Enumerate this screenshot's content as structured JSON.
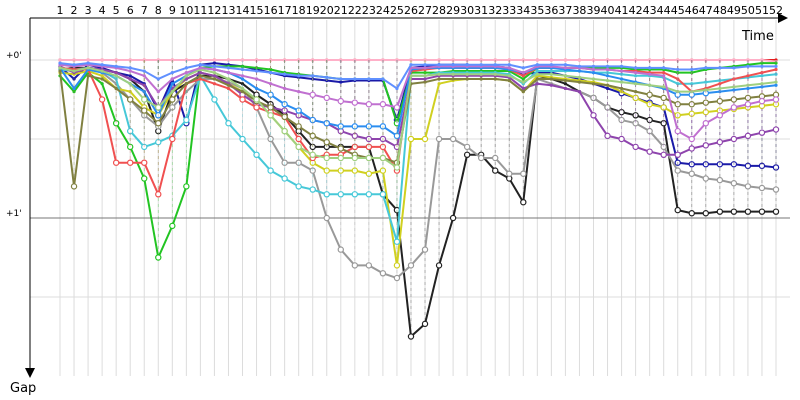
{
  "chart_data": {
    "type": "line",
    "xlabel": "Time",
    "ylabel": "Gap",
    "x_ticks": [
      "1",
      "2",
      "3",
      "4",
      "5",
      "6",
      "7",
      "8",
      "9",
      "10",
      "11",
      "12",
      "13",
      "14",
      "15",
      "16",
      "17",
      "18",
      "19",
      "20",
      "21",
      "22",
      "23",
      "24",
      "25",
      "26",
      "27",
      "28",
      "29",
      "30",
      "31",
      "32",
      "33",
      "34",
      "35",
      "36",
      "37",
      "38",
      "39",
      "40",
      "41",
      "42",
      "43",
      "44",
      "45",
      "46",
      "47",
      "48",
      "49",
      "50",
      "51",
      "52"
    ],
    "x_tick_labels": [
      "1",
      "2",
      "3",
      "4",
      "5",
      "6",
      "7",
      "8",
      "9",
      "10",
      "11",
      "12",
      "13",
      "14",
      "15",
      "16",
      "17",
      "18",
      "19",
      "20",
      "21",
      "22",
      "23",
      "24",
      "25",
      "26",
      "27",
      "28",
      "29",
      "30",
      "31",
      "32",
      "33",
      "34",
      "35",
      "36",
      "37",
      "38",
      "39",
      "40",
      "41",
      "42",
      "43",
      "44",
      "45",
      "46",
      "47",
      "48",
      "49",
      "50",
      "51",
      "52"
    ],
    "y_ticks": [
      0,
      1
    ],
    "y_tick_labels": [
      "+0'",
      "+1'"
    ],
    "ylim": [
      0,
      2
    ],
    "grid": true,
    "legend": "none",
    "series": [
      {
        "color": "#e31a1c",
        "values": [
          0.0,
          0.0,
          0.0,
          0.0,
          0.0,
          0.0,
          0.0,
          0.0,
          0.0,
          0.0,
          0.0,
          0.0,
          0.0,
          0.0,
          0.0,
          0.0,
          0.0,
          0.0,
          0.0,
          0.0,
          0.0,
          0.0,
          0.0,
          0.0,
          0.0,
          0.0,
          0.0,
          0.0,
          0.0,
          0.0,
          0.0,
          0.0,
          0.0,
          0.0,
          0.0,
          0.0,
          0.0,
          0.0,
          0.0,
          0.0,
          0.0,
          0.0,
          0.0,
          0.0,
          0.0,
          0.0,
          0.0,
          0.0,
          0.0,
          0.0,
          0.0,
          0.0
        ]
      },
      {
        "color": "#ffb0c8",
        "values": [
          0.0,
          0.0,
          0.0,
          0.0,
          0.0,
          0.0,
          0.0,
          0.0,
          0.0,
          0.0,
          0.0,
          0.0,
          0.0,
          0.0,
          0.0,
          0.0,
          0.0,
          0.0,
          0.0,
          0.0,
          0.0,
          0.0,
          0.0,
          0.0,
          0.0,
          0.0,
          0.0,
          0.0,
          0.0,
          0.0,
          0.0,
          0.0,
          0.0,
          0.0,
          0.0,
          0.0,
          0.0,
          0.0,
          0.0,
          0.0,
          0.0,
          0.0,
          0.0,
          0.0,
          0.0,
          0.0,
          0.0,
          0.0,
          0.0,
          0.0,
          0.0,
          0.01
        ]
      },
      {
        "color": "#1a1aa8",
        "values": [
          0.04,
          0.12,
          0.03,
          0.05,
          0.08,
          0.1,
          0.15,
          0.32,
          0.12,
          0.4,
          0.03,
          0.02,
          0.03,
          0.04,
          0.06,
          0.08,
          0.1,
          0.11,
          0.12,
          0.13,
          0.14,
          0.13,
          0.13,
          0.13,
          0.38,
          0.05,
          0.04,
          0.03,
          0.03,
          0.03,
          0.04,
          0.04,
          0.05,
          0.09,
          0.08,
          0.08,
          0.1,
          0.12,
          0.15,
          0.18,
          0.21,
          0.24,
          0.27,
          0.3,
          0.65,
          0.66,
          0.66,
          0.66,
          0.66,
          0.67,
          0.67,
          0.68
        ]
      },
      {
        "color": "#222222",
        "values": [
          0.06,
          0.05,
          0.05,
          0.06,
          0.08,
          0.12,
          0.2,
          0.45,
          0.2,
          0.15,
          0.1,
          0.1,
          0.12,
          0.15,
          0.22,
          0.28,
          0.35,
          0.45,
          0.55,
          0.55,
          0.55,
          0.55,
          0.55,
          0.85,
          0.95,
          1.75,
          1.67,
          1.3,
          1.0,
          0.6,
          0.6,
          0.7,
          0.75,
          0.9,
          0.1,
          0.12,
          0.15,
          0.2,
          0.24,
          0.3,
          0.33,
          0.35,
          0.38,
          0.4,
          0.95,
          0.97,
          0.97,
          0.96,
          0.96,
          0.96,
          0.96,
          0.96
        ]
      },
      {
        "color": "#999999",
        "values": [
          0.05,
          0.06,
          0.05,
          0.08,
          0.15,
          0.25,
          0.35,
          0.42,
          0.3,
          0.2,
          0.12,
          0.12,
          0.14,
          0.18,
          0.3,
          0.5,
          0.65,
          0.65,
          0.7,
          1.0,
          1.2,
          1.3,
          1.3,
          1.35,
          1.38,
          1.3,
          1.2,
          0.5,
          0.5,
          0.55,
          0.62,
          0.62,
          0.72,
          0.72,
          0.12,
          0.15,
          0.18,
          0.2,
          0.24,
          0.3,
          0.38,
          0.4,
          0.45,
          0.55,
          0.7,
          0.72,
          0.75,
          0.76,
          0.78,
          0.8,
          0.81,
          0.82
        ]
      },
      {
        "color": "#22c422",
        "values": [
          0.1,
          0.2,
          0.08,
          0.15,
          0.4,
          0.55,
          0.75,
          1.25,
          1.05,
          0.8,
          0.05,
          0.04,
          0.04,
          0.04,
          0.05,
          0.06,
          0.08,
          0.09,
          0.1,
          0.11,
          0.12,
          0.12,
          0.12,
          0.12,
          0.4,
          0.08,
          0.08,
          0.08,
          0.07,
          0.07,
          0.07,
          0.07,
          0.07,
          0.12,
          0.05,
          0.05,
          0.05,
          0.05,
          0.05,
          0.05,
          0.05,
          0.06,
          0.06,
          0.06,
          0.08,
          0.08,
          0.06,
          0.05,
          0.04,
          0.03,
          0.02,
          0.02
        ]
      },
      {
        "color": "#d0d020",
        "values": [
          0.08,
          0.09,
          0.07,
          0.1,
          0.18,
          0.2,
          0.3,
          0.35,
          0.2,
          0.12,
          0.08,
          0.1,
          0.15,
          0.2,
          0.25,
          0.35,
          0.45,
          0.55,
          0.65,
          0.7,
          0.7,
          0.7,
          0.72,
          0.7,
          1.3,
          0.5,
          0.5,
          0.15,
          0.13,
          0.12,
          0.12,
          0.12,
          0.13,
          0.2,
          0.1,
          0.11,
          0.12,
          0.13,
          0.14,
          0.16,
          0.2,
          0.24,
          0.28,
          0.3,
          0.35,
          0.34,
          0.33,
          0.32,
          0.31,
          0.3,
          0.29,
          0.28
        ]
      },
      {
        "color": "#46c8d8",
        "values": [
          0.06,
          0.07,
          0.05,
          0.07,
          0.12,
          0.45,
          0.55,
          0.52,
          0.48,
          0.38,
          0.1,
          0.25,
          0.4,
          0.5,
          0.6,
          0.7,
          0.75,
          0.8,
          0.82,
          0.85,
          0.85,
          0.85,
          0.85,
          0.85,
          1.15,
          0.1,
          0.1,
          0.08,
          0.08,
          0.08,
          0.08,
          0.08,
          0.09,
          0.15,
          0.07,
          0.07,
          0.07,
          0.07,
          0.08,
          0.08,
          0.09,
          0.1,
          0.1,
          0.11,
          0.15,
          0.15,
          0.14,
          0.13,
          0.12,
          0.11,
          0.1,
          0.09
        ]
      },
      {
        "color": "#8e44ad",
        "values": [
          0.04,
          0.08,
          0.05,
          0.06,
          0.08,
          0.12,
          0.16,
          0.3,
          0.18,
          0.12,
          0.08,
          0.1,
          0.15,
          0.22,
          0.28,
          0.3,
          0.32,
          0.35,
          0.38,
          0.4,
          0.45,
          0.48,
          0.5,
          0.5,
          0.55,
          0.12,
          0.12,
          0.1,
          0.1,
          0.1,
          0.1,
          0.1,
          0.11,
          0.18,
          0.15,
          0.16,
          0.18,
          0.2,
          0.35,
          0.48,
          0.5,
          0.55,
          0.58,
          0.6,
          0.6,
          0.56,
          0.54,
          0.52,
          0.5,
          0.48,
          0.46,
          0.44
        ]
      },
      {
        "color": "#f05050",
        "values": [
          0.05,
          0.06,
          0.06,
          0.25,
          0.65,
          0.65,
          0.65,
          0.85,
          0.5,
          0.15,
          0.12,
          0.15,
          0.18,
          0.25,
          0.3,
          0.33,
          0.36,
          0.5,
          0.62,
          0.6,
          0.6,
          0.55,
          0.55,
          0.55,
          0.7,
          0.07,
          0.06,
          0.05,
          0.05,
          0.05,
          0.05,
          0.05,
          0.06,
          0.1,
          0.05,
          0.05,
          0.05,
          0.05,
          0.06,
          0.06,
          0.07,
          0.07,
          0.08,
          0.08,
          0.12,
          0.2,
          0.18,
          0.15,
          0.12,
          0.1,
          0.08,
          0.06
        ]
      },
      {
        "color": "#2a8df0",
        "values": [
          0.05,
          0.18,
          0.06,
          0.08,
          0.1,
          0.15,
          0.2,
          0.35,
          0.15,
          0.1,
          0.05,
          0.06,
          0.08,
          0.12,
          0.18,
          0.22,
          0.28,
          0.32,
          0.38,
          0.4,
          0.42,
          0.42,
          0.42,
          0.42,
          0.48,
          0.06,
          0.05,
          0.05,
          0.05,
          0.05,
          0.05,
          0.05,
          0.06,
          0.08,
          0.05,
          0.05,
          0.06,
          0.07,
          0.08,
          0.1,
          0.12,
          0.14,
          0.16,
          0.18,
          0.22,
          0.22,
          0.21,
          0.2,
          0.19,
          0.18,
          0.17,
          0.16
        ]
      },
      {
        "color": "#808040",
        "values": [
          0.07,
          0.8,
          0.1,
          0.12,
          0.18,
          0.25,
          0.32,
          0.4,
          0.25,
          0.15,
          0.1,
          0.12,
          0.16,
          0.2,
          0.26,
          0.3,
          0.36,
          0.42,
          0.48,
          0.52,
          0.56,
          0.6,
          0.62,
          0.62,
          0.65,
          0.15,
          0.14,
          0.12,
          0.12,
          0.12,
          0.12,
          0.12,
          0.13,
          0.2,
          0.12,
          0.12,
          0.13,
          0.14,
          0.15,
          0.16,
          0.18,
          0.2,
          0.22,
          0.24,
          0.28,
          0.28,
          0.27,
          0.26,
          0.25,
          0.24,
          0.23,
          0.22
        ]
      },
      {
        "color": "#a0d080",
        "values": [
          0.05,
          0.07,
          0.05,
          0.07,
          0.1,
          0.15,
          0.25,
          0.3,
          0.2,
          0.1,
          0.06,
          0.08,
          0.12,
          0.18,
          0.25,
          0.35,
          0.45,
          0.55,
          0.6,
          0.62,
          0.62,
          0.62,
          0.62,
          0.62,
          0.68,
          0.1,
          0.1,
          0.09,
          0.09,
          0.09,
          0.09,
          0.09,
          0.1,
          0.14,
          0.09,
          0.09,
          0.1,
          0.11,
          0.12,
          0.13,
          0.14,
          0.15,
          0.16,
          0.17,
          0.2,
          0.2,
          0.19,
          0.18,
          0.17,
          0.16,
          0.15,
          0.14
        ]
      },
      {
        "color": "#c070d0",
        "values": [
          0.03,
          0.04,
          0.03,
          0.04,
          0.05,
          0.07,
          0.1,
          0.2,
          0.12,
          0.08,
          0.05,
          0.06,
          0.08,
          0.1,
          0.12,
          0.15,
          0.18,
          0.2,
          0.22,
          0.24,
          0.26,
          0.27,
          0.28,
          0.28,
          0.3,
          0.05,
          0.05,
          0.04,
          0.04,
          0.04,
          0.04,
          0.04,
          0.05,
          0.08,
          0.04,
          0.04,
          0.05,
          0.05,
          0.06,
          0.06,
          0.07,
          0.08,
          0.09,
          0.1,
          0.45,
          0.5,
          0.4,
          0.35,
          0.3,
          0.28,
          0.26,
          0.25
        ]
      },
      {
        "color": "#6090ff",
        "values": [
          0.02,
          0.03,
          0.02,
          0.03,
          0.04,
          0.05,
          0.07,
          0.12,
          0.08,
          0.05,
          0.03,
          0.04,
          0.05,
          0.06,
          0.07,
          0.08,
          0.09,
          0.1,
          0.1,
          0.11,
          0.12,
          0.12,
          0.12,
          0.12,
          0.18,
          0.03,
          0.03,
          0.03,
          0.03,
          0.03,
          0.03,
          0.03,
          0.03,
          0.05,
          0.03,
          0.03,
          0.03,
          0.04,
          0.04,
          0.04,
          0.04,
          0.05,
          0.05,
          0.05,
          0.06,
          0.06,
          0.05,
          0.05,
          0.05,
          0.04,
          0.04,
          0.04
        ]
      }
    ]
  }
}
